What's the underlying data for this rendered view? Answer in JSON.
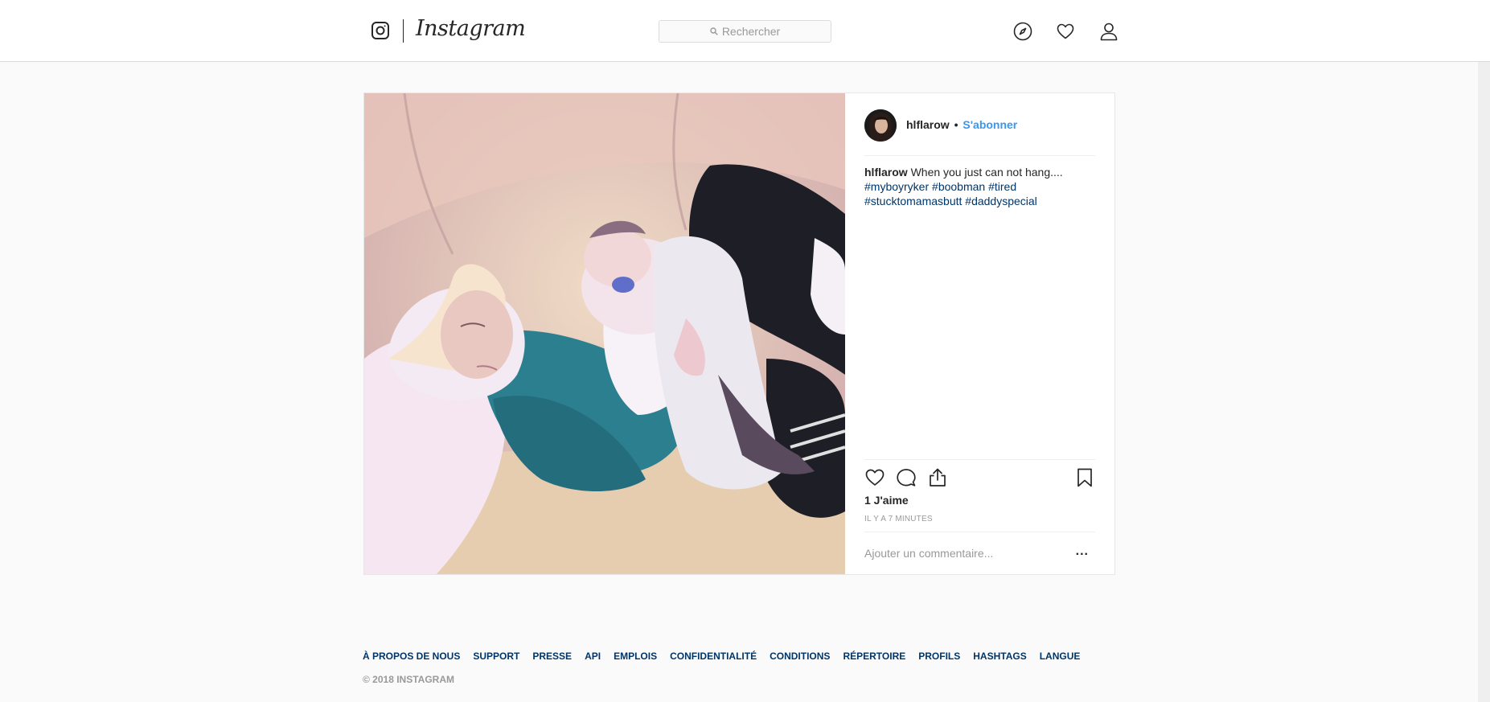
{
  "header": {
    "brand": "Instagram",
    "search_placeholder": "Rechercher"
  },
  "post": {
    "username": "hlflarow",
    "separator": "•",
    "follow_label": "S'abonner",
    "caption_user": "hlflarow",
    "caption_text": "When you just can not hang....",
    "hashtags": [
      "#myboyryker",
      "#boobman",
      "#tired",
      "#stucktomamasbutt",
      "#daddyspecial"
    ],
    "likes": "1 J'aime",
    "timestamp": "IL Y A 7 MINUTES",
    "comment_placeholder": "Ajouter un commentaire...",
    "more_label": "..."
  },
  "footer": {
    "links": [
      "À PROPOS DE NOUS",
      "SUPPORT",
      "PRESSE",
      "API",
      "EMPLOIS",
      "CONFIDENTIALITÉ",
      "CONDITIONS",
      "RÉPERTOIRE",
      "PROFILS",
      "HASHTAGS",
      "LANGUE"
    ],
    "copyright": "© 2018 INSTAGRAM"
  },
  "icons": {
    "logo": "instagram-camera-icon",
    "search": "search-icon",
    "explore": "compass-icon",
    "activity": "heart-icon",
    "profile": "person-icon",
    "like": "heart-icon",
    "comment": "comment-bubble-icon",
    "share": "share-icon",
    "save": "bookmark-icon"
  },
  "colors": {
    "link_blue": "#3897f0",
    "hashtag_blue": "#003569",
    "muted": "#999999",
    "border": "#dbdbdb"
  }
}
